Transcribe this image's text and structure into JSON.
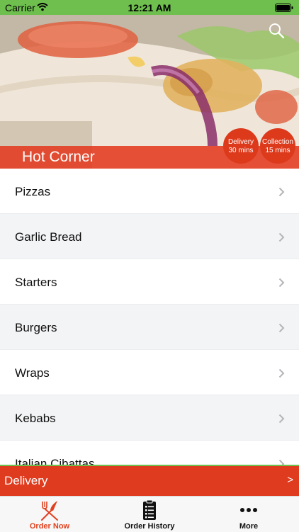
{
  "status_bar": {
    "carrier": "Carrier",
    "time": "12:21 AM"
  },
  "header": {
    "restaurant_name": "Hot Corner",
    "delivery_badge": {
      "title": "Delivery",
      "time": "30 mins"
    },
    "collection_badge": {
      "title": "Collection",
      "time": "15 mins"
    }
  },
  "menu": {
    "items": [
      {
        "label": "Pizzas"
      },
      {
        "label": "Garlic Bread"
      },
      {
        "label": "Starters"
      },
      {
        "label": "Burgers"
      },
      {
        "label": "Wraps"
      },
      {
        "label": "Kebabs"
      },
      {
        "label": "Italian Cibattas"
      }
    ]
  },
  "delivery_bar": {
    "label": "Delivery",
    "arrow": ">"
  },
  "tabs": [
    {
      "label": "Order Now",
      "active": true
    },
    {
      "label": "Order History",
      "active": false
    },
    {
      "label": "More",
      "active": false
    }
  ],
  "colors": {
    "accent": "#df3b1f",
    "status_green": "#6fbf4f",
    "active_tab": "#e0401f",
    "inactive_tab": "#111111"
  },
  "icons": {
    "search": "search-icon",
    "chevron": "chevron-right-icon",
    "order_now": "fork-knife-icon",
    "order_history": "clipboard-list-icon",
    "more": "more-dots-icon"
  }
}
